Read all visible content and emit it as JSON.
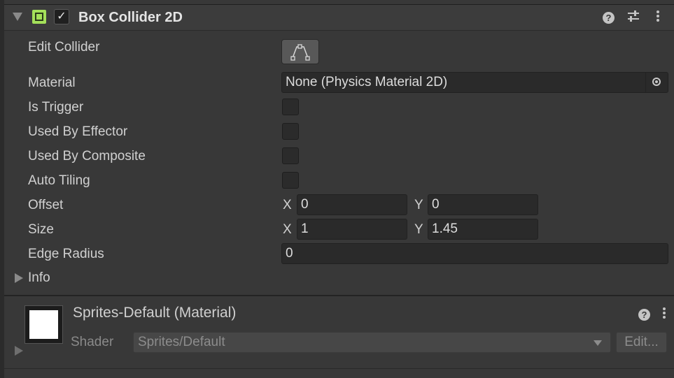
{
  "component": {
    "title": "Box Collider 2D",
    "enabled_mark": "✓"
  },
  "properties": {
    "edit_collider_label": "Edit Collider",
    "material_label": "Material",
    "material_value": "None (Physics Material 2D)",
    "is_trigger_label": "Is Trigger",
    "used_by_effector_label": "Used By Effector",
    "used_by_composite_label": "Used By Composite",
    "auto_tiling_label": "Auto Tiling",
    "offset_label": "Offset",
    "offset_x": "0",
    "offset_y": "0",
    "size_label": "Size",
    "size_x": "1",
    "size_y": "1.45",
    "edge_radius_label": "Edge Radius",
    "edge_radius_value": "0",
    "info_label": "Info",
    "axis_x": "X",
    "axis_y": "Y"
  },
  "material_section": {
    "title": "Sprites-Default (Material)",
    "shader_label": "Shader",
    "shader_value": "Sprites/Default",
    "edit_label": "Edit..."
  },
  "icons": {
    "help": "?",
    "collider_color": "#a4e05a"
  }
}
